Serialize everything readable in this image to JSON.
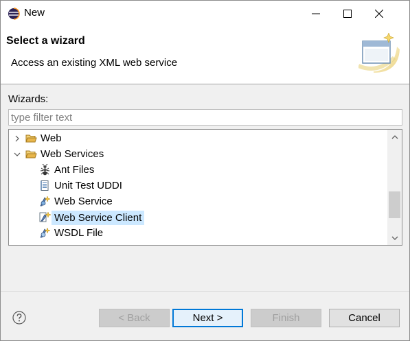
{
  "window": {
    "title": "New"
  },
  "header": {
    "title": "Select a wizard",
    "description": "Access an existing XML web service"
  },
  "wizards": {
    "label": "Wizards:",
    "filter_placeholder": "type filter text",
    "tree": [
      {
        "label": "Web",
        "expanded": false,
        "icon": "folder-icon"
      },
      {
        "label": "Web Services",
        "expanded": true,
        "icon": "folder-icon"
      },
      {
        "label": "Ant Files",
        "icon": "ant-icon"
      },
      {
        "label": "Unit Test UDDI",
        "icon": "uddi-icon"
      },
      {
        "label": "Web Service",
        "icon": "web-service-icon"
      },
      {
        "label": "Web Service Client",
        "icon": "web-service-client-icon",
        "selected": true
      },
      {
        "label": "WSDL File",
        "icon": "wsdl-icon"
      }
    ]
  },
  "buttons": {
    "back": "< Back",
    "next": "Next >",
    "finish": "Finish",
    "cancel": "Cancel"
  },
  "colors": {
    "selection": "#cce8ff",
    "default_button_border": "#0078d7",
    "folder": "#e8b64b"
  }
}
